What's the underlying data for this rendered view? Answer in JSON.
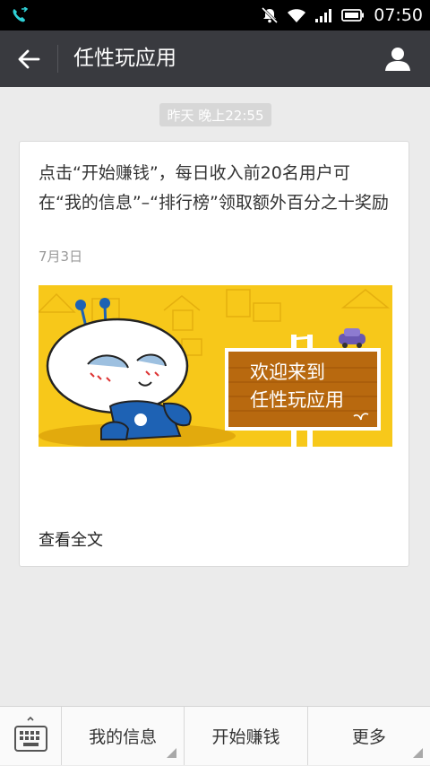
{
  "status_bar": {
    "time": "07:50",
    "icons": [
      "phone-call-icon",
      "mute-icon",
      "wifi-icon",
      "signal-icon",
      "battery-icon"
    ]
  },
  "header": {
    "title": "任性玩应用",
    "back_icon": "back-arrow-icon",
    "profile_icon": "person-icon"
  },
  "conversation": {
    "timestamp": "昨天 晚上22:55"
  },
  "article": {
    "text": "点击“开始赚钱”，每日收入前20名用户可在“我的信息”–“排行榜”领取额外百分之十奖励",
    "date": "7月3日",
    "banner_text_line1": "欢迎来到",
    "banner_text_line2": "任性玩应用",
    "read_more": "查看全文"
  },
  "bottom_menu": {
    "keyboard_icon": "keyboard-icon",
    "items": [
      {
        "label": "我的信息"
      },
      {
        "label": "开始赚钱"
      },
      {
        "label": "更多"
      }
    ]
  },
  "colors": {
    "header_bg": "#393a3f",
    "status_bg": "#000000",
    "page_bg": "#ebebeb",
    "banner_yellow": "#f7c81a",
    "sign_brown": "#b8690f"
  }
}
